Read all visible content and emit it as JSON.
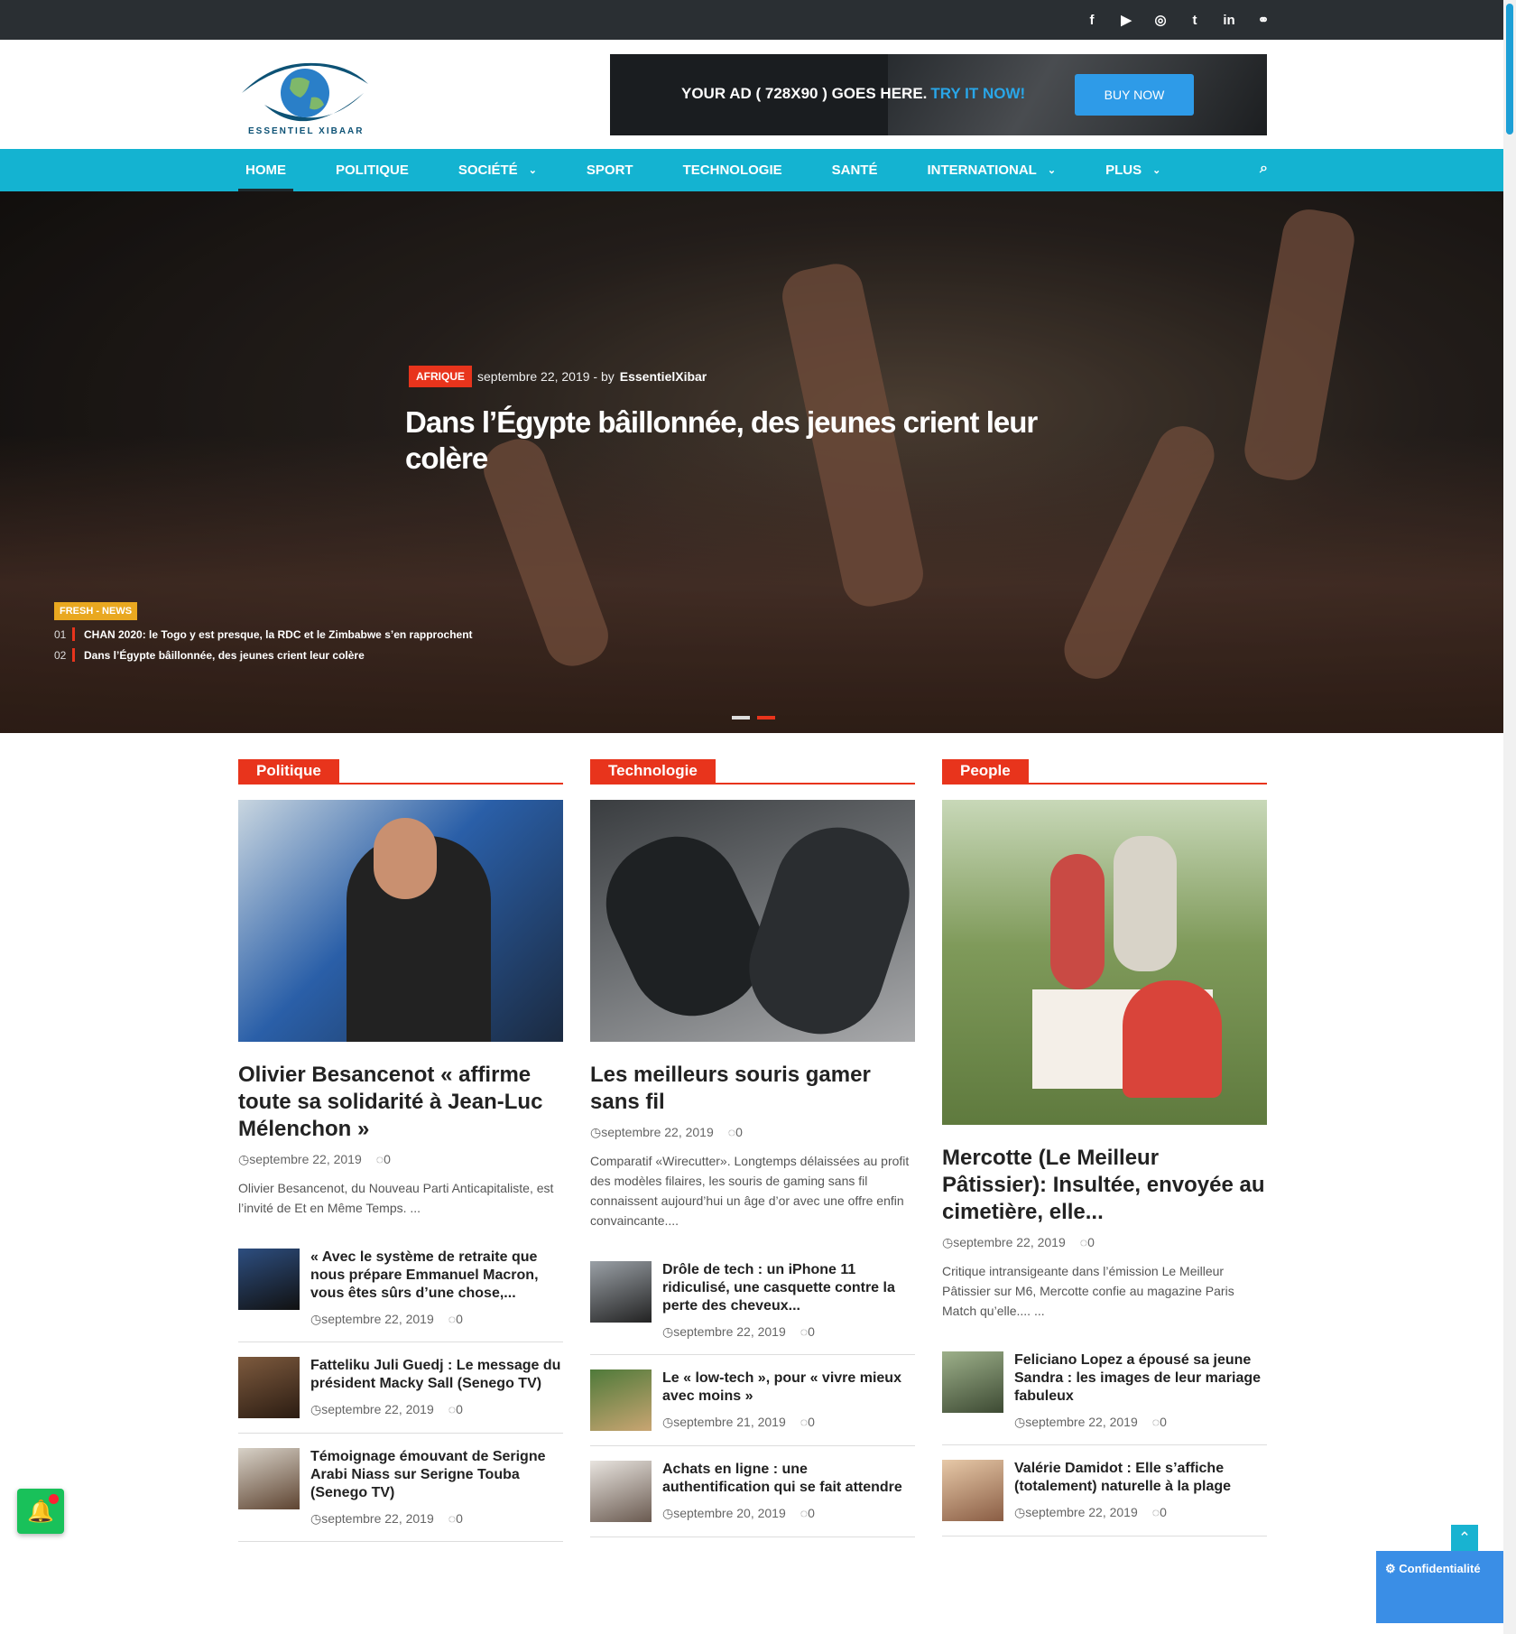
{
  "social": {
    "icons": [
      "facebook-icon",
      "youtube-icon",
      "instagram-icon",
      "twitter-icon",
      "linkedin-icon",
      "link-icon"
    ],
    "glyphs": [
      "f",
      "▶",
      "◎",
      "t",
      "in",
      "⚭"
    ]
  },
  "logo": {
    "name": "ESSENTIEL XIBAAR"
  },
  "ad": {
    "text": "YOUR AD ( 728X90 ) GOES HERE.",
    "try": "TRY IT NOW!",
    "button": "BUY NOW"
  },
  "nav": {
    "items": [
      "HOME",
      "POLITIQUE",
      "SOCIÉTÉ",
      "SPORT",
      "TECHNOLOGIE",
      "SANTÉ",
      "INTERNATIONAL",
      "PLUS"
    ],
    "search_glyph": "⌕"
  },
  "hero": {
    "category": "AFRIQUE",
    "date": "septembre 22, 2019 - by",
    "author": "EssentielXibar",
    "title": "Dans l’Égypte bâillonnée, des jeunes crient leur colère"
  },
  "fresh": {
    "label": "FRESH - NEWS",
    "items": [
      {
        "num": "01",
        "text": "CHAN 2020: le Togo y est presque, la RDC et le Zimbabwe s’en rapprochent"
      },
      {
        "num": "02",
        "text": "Dans l’Égypte bâillonnée, des jeunes crient leur colère"
      }
    ]
  },
  "columns": [
    {
      "tag": "Politique",
      "title": "Olivier Besancenot « affirme toute sa solidarité à Jean-Luc Mélenchon »",
      "date": "septembre 22, 2019",
      "comments": "0",
      "excerpt": "Olivier Besancenot, du Nouveau Parti Anticapitaliste, est l’invité de Et en Même Temps. ...",
      "list": [
        {
          "title": "« Avec le système de retraite que nous prépare Emmanuel Macron, vous êtes sûrs d’une chose,...",
          "date": "septembre 22, 2019",
          "comments": "0"
        },
        {
          "title": "Fatteliku Juli Guedj : Le message du président Macky Sall (Senego TV)",
          "date": "septembre 22, 2019",
          "comments": "0"
        },
        {
          "title": "Témoignage émouvant de Serigne Arabi Niass sur Serigne Touba (Senego TV)",
          "date": "septembre 22, 2019",
          "comments": "0"
        }
      ]
    },
    {
      "tag": "Technologie",
      "title": "Les meilleurs souris gamer sans fil",
      "date": "septembre 22, 2019",
      "comments": "0",
      "excerpt": "Comparatif «Wirecutter». Longtemps délaissées au profit des modèles filaires, les souris de gaming sans fil connaissent aujourd’hui un âge d’or avec une offre enfin convaincante....",
      "list": [
        {
          "title": "Drôle de tech : un iPhone 11 ridiculisé, une casquette contre la perte des cheveux...",
          "date": "septembre 22, 2019",
          "comments": "0"
        },
        {
          "title": "Le « low-tech », pour « vivre mieux avec moins »",
          "date": "septembre 21, 2019",
          "comments": "0"
        },
        {
          "title": "Achats en ligne : une authentification qui se fait attendre",
          "date": "septembre 20, 2019",
          "comments": "0"
        }
      ]
    },
    {
      "tag": "People",
      "title": "Mercotte (Le Meilleur Pâtissier): Insultée, envoyée au cimetière, elle...",
      "date": "septembre 22, 2019",
      "comments": "0",
      "excerpt": "Critique intransigeante dans l’émission Le Meilleur Pâtissier sur M6, Mercotte confie au magazine Paris Match qu’elle.... ...",
      "list": [
        {
          "title": "Feliciano Lopez a épousé sa jeune Sandra : les images de leur mariage fabuleux",
          "date": "septembre 22, 2019",
          "comments": "0"
        },
        {
          "title": "Valérie Damidot : Elle s’affiche (totalement) naturelle à la plage",
          "date": "septembre 22, 2019",
          "comments": "0"
        }
      ]
    }
  ],
  "widgets": {
    "privacy": "Confidentialité",
    "up": "⌃",
    "bell": "🔔"
  }
}
